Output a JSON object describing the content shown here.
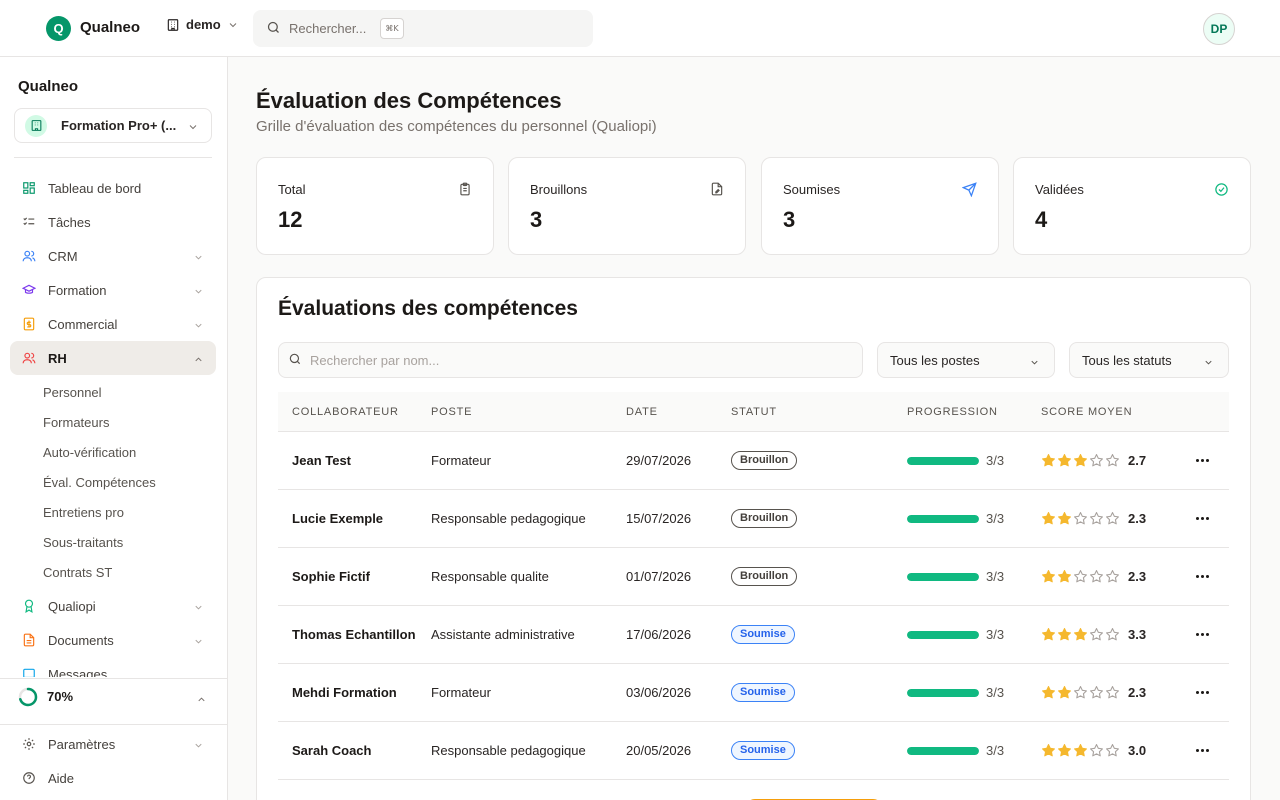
{
  "topbar": {
    "logo_letter": "Q",
    "app_name": "Qualneo",
    "workspace": "demo",
    "search_placeholder": "Rechercher...",
    "search_shortcut": "⌘K",
    "user_initials": "DP"
  },
  "sidebar": {
    "org_title": "Qualneo",
    "org_select": "Formation Pro+ (...",
    "items": [
      {
        "label": "Tableau de bord",
        "icon": "dashboard-icon",
        "color": "#059669",
        "chevron": false
      },
      {
        "label": "Tâches",
        "icon": "tasks-icon",
        "color": "#57534e",
        "chevron": false
      },
      {
        "label": "CRM",
        "icon": "users-icon",
        "color": "#3b82f6",
        "chevron": true
      },
      {
        "label": "Formation",
        "icon": "graduation-cap-icon",
        "color": "#7c3aed",
        "chevron": true
      },
      {
        "label": "Commercial",
        "icon": "document-dollar-icon",
        "color": "#f59e0b",
        "chevron": true
      },
      {
        "label": "RH",
        "icon": "users-icon",
        "color": "#ef4444",
        "chevron": true,
        "active": true,
        "expanded": true
      }
    ],
    "rh_subitems": [
      "Personnel",
      "Formateurs",
      "Auto-vérification",
      "Éval. Compétences",
      "Entretiens pro",
      "Sous-traitants",
      "Contrats ST"
    ],
    "items_after": [
      {
        "label": "Qualiopi",
        "icon": "award-icon",
        "color": "#10b981",
        "chevron": true
      },
      {
        "label": "Documents",
        "icon": "file-icon",
        "color": "#f97316",
        "chevron": true
      },
      {
        "label": "Messages",
        "icon": "message-icon",
        "color": "#0ea5e9",
        "chevron": false
      }
    ],
    "progress_label": "70%",
    "progress_value": 0.7,
    "bottom_items": [
      {
        "label": "Paramètres",
        "icon": "gear-icon",
        "chevron": true
      },
      {
        "label": "Aide",
        "icon": "help-icon",
        "chevron": false
      }
    ]
  },
  "page": {
    "title": "Évaluation des Compétences",
    "subtitle": "Grille d'évaluation des compétences du personnel (Qualiopi)"
  },
  "stats": [
    {
      "label": "Total",
      "value": "12",
      "icon": "clipboard-icon",
      "color": "#57534e"
    },
    {
      "label": "Brouillons",
      "value": "3",
      "icon": "file-edit-icon",
      "color": "#57534e"
    },
    {
      "label": "Soumises",
      "value": "3",
      "icon": "send-icon",
      "color": "#3b82f6"
    },
    {
      "label": "Validées",
      "value": "4",
      "icon": "check-circle-icon",
      "color": "#10b981"
    }
  ],
  "panel": {
    "title": "Évaluations des compétences",
    "search_placeholder": "Rechercher par nom...",
    "filter_poste": "Tous les postes",
    "filter_statut": "Tous les statuts"
  },
  "table": {
    "headers": [
      "COLLABORATEUR",
      "POSTE",
      "DATE",
      "STATUT",
      "PROGRESSION",
      "SCORE MOYEN"
    ],
    "rows": [
      {
        "name": "Jean Test",
        "poste": "Formateur",
        "date": "29/07/2026",
        "statut": "Brouillon",
        "statut_type": "draft",
        "progress": "3/3",
        "progress_value": 1.0,
        "stars": 3,
        "score": "2.7"
      },
      {
        "name": "Lucie Exemple",
        "poste": "Responsable pedagogique",
        "date": "15/07/2026",
        "statut": "Brouillon",
        "statut_type": "draft",
        "progress": "3/3",
        "progress_value": 1.0,
        "stars": 2,
        "score": "2.3"
      },
      {
        "name": "Sophie Fictif",
        "poste": "Responsable qualite",
        "date": "01/07/2026",
        "statut": "Brouillon",
        "statut_type": "draft",
        "progress": "3/3",
        "progress_value": 1.0,
        "stars": 2,
        "score": "2.3"
      },
      {
        "name": "Thomas Echantillon",
        "poste": "Assistante administrative",
        "date": "17/06/2026",
        "statut": "Soumise",
        "statut_type": "sent",
        "progress": "3/3",
        "progress_value": 1.0,
        "stars": 3,
        "score": "3.3"
      },
      {
        "name": "Mehdi Formation",
        "poste": "Formateur",
        "date": "03/06/2026",
        "statut": "Soumise",
        "statut_type": "sent",
        "progress": "3/3",
        "progress_value": 1.0,
        "stars": 2,
        "score": "2.3"
      },
      {
        "name": "Sarah Coach",
        "poste": "Responsable pedagogique",
        "date": "20/05/2026",
        "statut": "Soumise",
        "statut_type": "sent",
        "progress": "3/3",
        "progress_value": 1.0,
        "stars": 3,
        "score": "3.0"
      }
    ]
  },
  "colors": {
    "brand": "#059669",
    "progress": "#10b981",
    "star": "#f5b82e",
    "star_empty": "#a8a29e"
  }
}
